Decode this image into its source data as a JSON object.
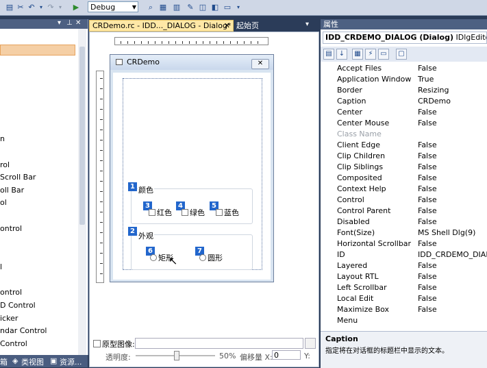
{
  "toolbar": {
    "config_value": "Debug"
  },
  "toolbox": {
    "items": [
      "n",
      "rol",
      "Scroll Bar",
      "oll Bar",
      "ol",
      "ontrol",
      "l",
      "ontrol",
      "D Control",
      "icker",
      "ndar Control",
      "Control"
    ]
  },
  "bottom_tabs": {
    "tab1": "类视图",
    "tab2": "资源...",
    "tab0": "箱"
  },
  "document": {
    "active_tab": "CRDemo.rc - IDD..._DIALOG - Dialog*",
    "active_tab_close": "✕",
    "second_tab": "起始页"
  },
  "dialog": {
    "title": "CRDemo",
    "close_glyph": "✕",
    "group1": {
      "label": "颜色",
      "badge": "1"
    },
    "group2": {
      "label": "外观",
      "badge": "2"
    },
    "options": [
      {
        "badge": "3",
        "label": "红色"
      },
      {
        "badge": "4",
        "label": "绿色"
      },
      {
        "badge": "5",
        "label": "蓝色"
      },
      {
        "badge": "6",
        "label": "矩形"
      },
      {
        "badge": "7",
        "label": "圆形"
      }
    ]
  },
  "doc_bottom": {
    "prototype_label": "原型图像:",
    "transparency_label": "透明度:",
    "transparency_value": "50%",
    "offset_label": "偏移量 X:",
    "offset_x": "0",
    "offset_y_label": "Y:"
  },
  "properties": {
    "header": "属性",
    "object": "IDD_CRDEMO_DIALOG (Dialog)",
    "object_type": "IDlgEditor",
    "rows": [
      {
        "name": "Accept Files",
        "value": "False"
      },
      {
        "name": "Application Window",
        "value": "True"
      },
      {
        "name": "Border",
        "value": "Resizing"
      },
      {
        "name": "Caption",
        "value": "CRDemo"
      },
      {
        "name": "Center",
        "value": "False"
      },
      {
        "name": "Center Mouse",
        "value": "False"
      },
      {
        "name": "Class Name",
        "value": ""
      },
      {
        "name": "Client Edge",
        "value": "False"
      },
      {
        "name": "Clip Children",
        "value": "False"
      },
      {
        "name": "Clip Siblings",
        "value": "False"
      },
      {
        "name": "Composited",
        "value": "False"
      },
      {
        "name": "Context Help",
        "value": "False"
      },
      {
        "name": "Control",
        "value": "False"
      },
      {
        "name": "Control Parent",
        "value": "False"
      },
      {
        "name": "Disabled",
        "value": "False"
      },
      {
        "name": "Font(Size)",
        "value": "MS Shell Dlg(9)"
      },
      {
        "name": "Horizontal Scrollbar",
        "value": "False"
      },
      {
        "name": "ID",
        "value": "IDD_CRDEMO_DIALO"
      },
      {
        "name": "Layered",
        "value": "False"
      },
      {
        "name": "Layout RTL",
        "value": "False"
      },
      {
        "name": "Left Scrollbar",
        "value": "False"
      },
      {
        "name": "Local Edit",
        "value": "False"
      },
      {
        "name": "Maximize Box",
        "value": "False"
      },
      {
        "name": "Menu",
        "value": ""
      }
    ],
    "desc_title": "Caption",
    "desc_text": "指定将在对话框的标题栏中显示的文本。"
  }
}
